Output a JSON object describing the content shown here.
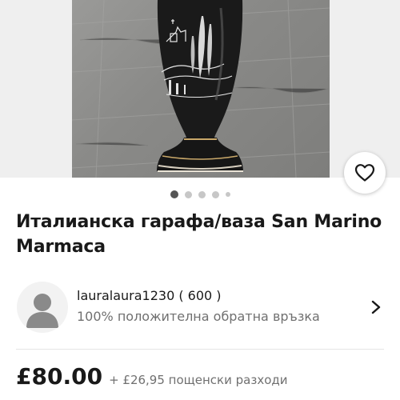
{
  "listing": {
    "title": "Италианска гарафа/ваза San Marino Marmaca",
    "gallery": {
      "image_count": 5,
      "active_index": 0
    }
  },
  "seller": {
    "name": "lauralaura1230 ( 600 )",
    "feedback": "100% положителна обратна връзка"
  },
  "pricing": {
    "price": "£80.00",
    "shipping": "+ £26,95 пощенски разходи"
  },
  "icons": {
    "favorite": "heart-outline-icon",
    "avatar": "user-silhouette-icon",
    "navigate": "chevron-right-icon"
  },
  "colors": {
    "text_primary": "#191919",
    "text_secondary": "#707070",
    "dot_active": "#555555",
    "dot_inactive": "#c7c7c7"
  }
}
